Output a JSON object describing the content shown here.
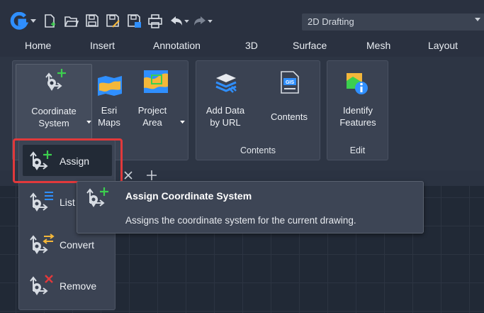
{
  "quick_access": {
    "workspace": "2D Drafting",
    "icons": [
      "app-logo-icon",
      "new-file-icon",
      "open-icon",
      "save-icon",
      "save-as-icon",
      "save-to-web-icon",
      "print-icon",
      "undo-icon",
      "redo-icon"
    ]
  },
  "ribbon_tabs": [
    "Home",
    "Insert",
    "Annotation",
    "3D",
    "Surface",
    "Mesh",
    "Layout"
  ],
  "ribbon": {
    "panel1": {
      "coordinate_system_line1": "Coordinate",
      "coordinate_system_line2": "System",
      "esri_line1": "Esri",
      "esri_line2": "Maps",
      "project_line1": "Project",
      "project_line2": "Area"
    },
    "panel2": {
      "add_data_line1": "Add Data",
      "add_data_line2": "by URL",
      "contents_button": "Contents",
      "title": "Contents"
    },
    "panel3": {
      "identify_line1": "Identify",
      "identify_line2": "Features",
      "title": "Edit"
    }
  },
  "menu": {
    "items": [
      {
        "label": "Assign",
        "icon": "assign-coordinate-icon"
      },
      {
        "label": "List",
        "icon": "list-coordinate-icon"
      },
      {
        "label": "Convert",
        "icon": "convert-coordinate-icon"
      },
      {
        "label": "Remove",
        "icon": "remove-coordinate-icon"
      }
    ]
  },
  "tooltip": {
    "title": "Assign Coordinate System",
    "description": "Assigns the coordinate system for the current drawing."
  },
  "colors": {
    "background": "#2b3342",
    "accent_green": "#3ccf4e",
    "highlight_red": "#e1393b",
    "logo_blue": "#2f8fff"
  }
}
